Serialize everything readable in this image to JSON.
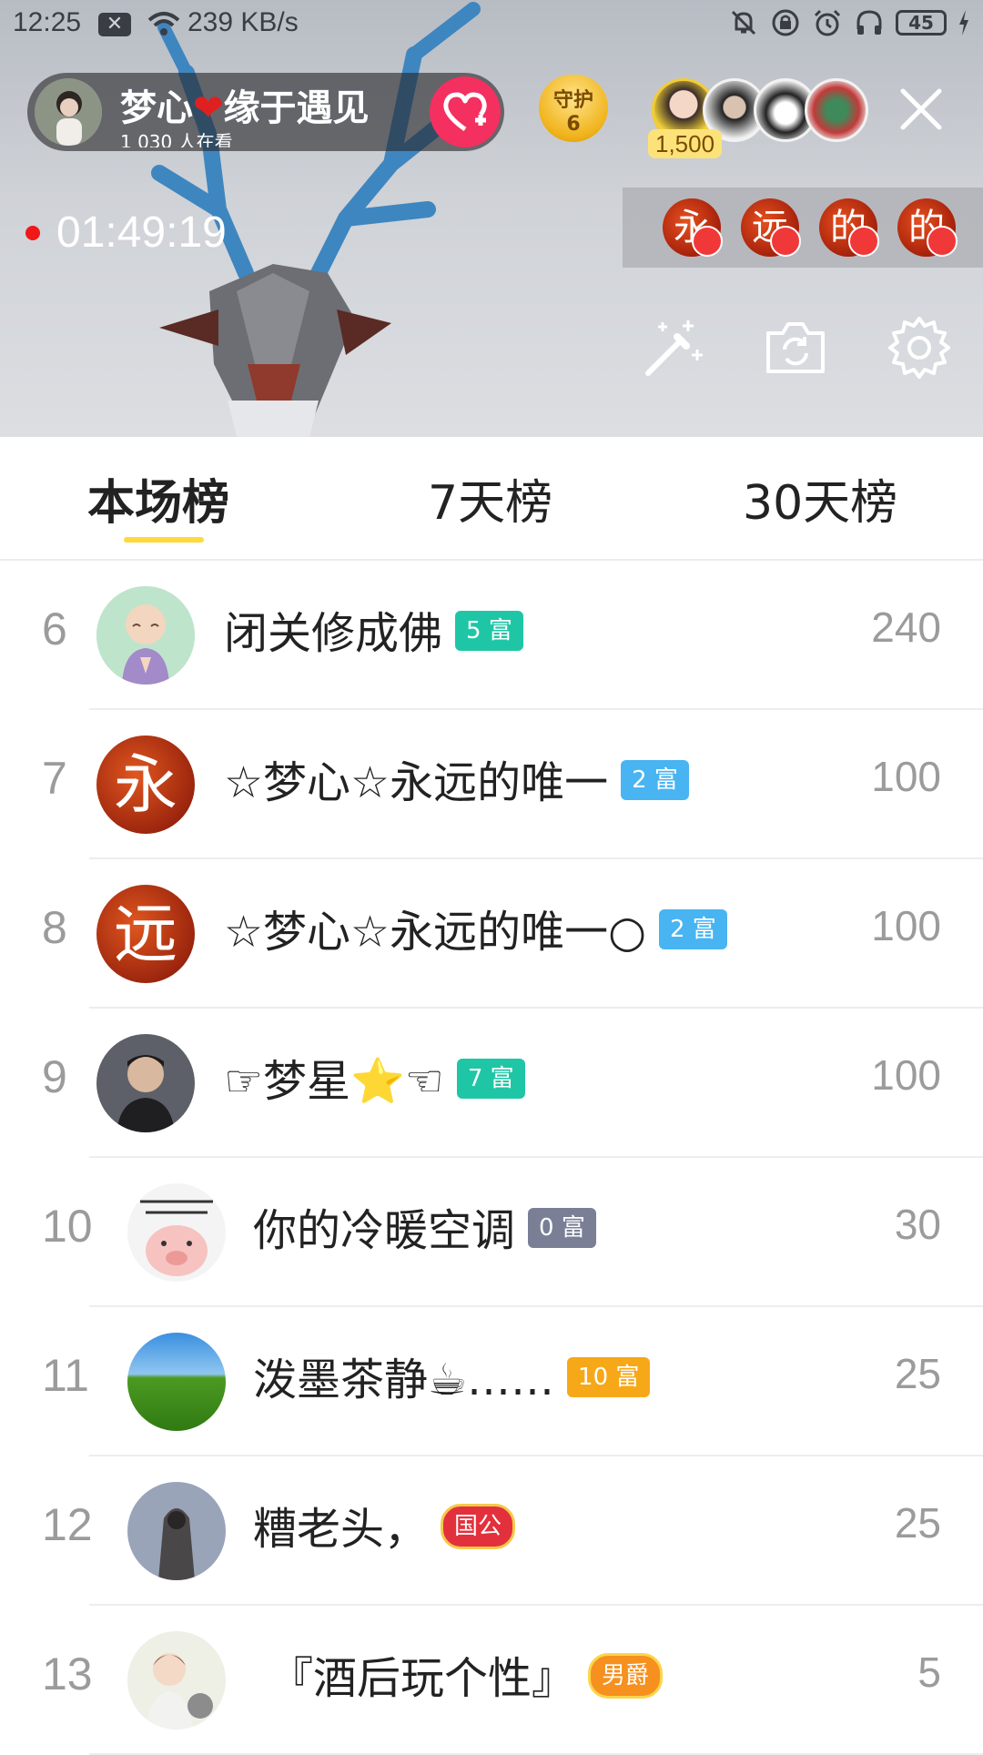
{
  "status_bar": {
    "time": "12:25",
    "net_speed": "239 KB/s",
    "battery": "45"
  },
  "host": {
    "name_part1": "梦心",
    "heart": "❤",
    "name_part2": "缘于遇见",
    "viewers_line": "1 030 人在看"
  },
  "guard": {
    "label": "守护",
    "count": "6"
  },
  "audience": {
    "count": "1,500"
  },
  "live": {
    "timer": "01:49:19"
  },
  "fan_badges": [
    "永",
    "远",
    "的",
    "的"
  ],
  "tabs": [
    {
      "label": "本场榜",
      "active": true
    },
    {
      "label": "7天榜",
      "active": false
    },
    {
      "label": "30天榜",
      "active": false
    }
  ],
  "ranking": [
    {
      "rank": "6",
      "name": "闭关修成佛",
      "tag": "5 富",
      "tag_color": "#1fc6a6",
      "score": "240"
    },
    {
      "rank": "7",
      "name": "☆梦心☆永远的唯一",
      "tag": "2 富",
      "tag_color": "#48b4f2",
      "score": "100"
    },
    {
      "rank": "8",
      "name": "☆梦心☆永远的唯一○",
      "tag": "2 富",
      "tag_color": "#48b4f2",
      "score": "100"
    },
    {
      "rank": "9",
      "name": "☞梦星⭐☜",
      "tag": "7 富",
      "tag_color": "#1fc6a6",
      "score": "100"
    },
    {
      "rank": "10",
      "name": "你的冷暖空调",
      "tag": "0 富",
      "tag_color": "#7a7f96",
      "score": "30"
    },
    {
      "rank": "11",
      "name": "泼墨茶静☕……",
      "tag": "10 富",
      "tag_color": "#f7a818",
      "score": "25"
    },
    {
      "rank": "12",
      "name": "糟老头，",
      "tag": "国公",
      "tag_color": "#e2313c",
      "score": "25"
    },
    {
      "rank": "13",
      "name": "『酒后玩个性』",
      "tag": "男爵",
      "tag_color": "#f6901e",
      "score": "5"
    }
  ],
  "colors": {
    "tab_indicator": "#ffd83a",
    "follow_button": "#f3305f",
    "live_dot": "#f01818"
  }
}
